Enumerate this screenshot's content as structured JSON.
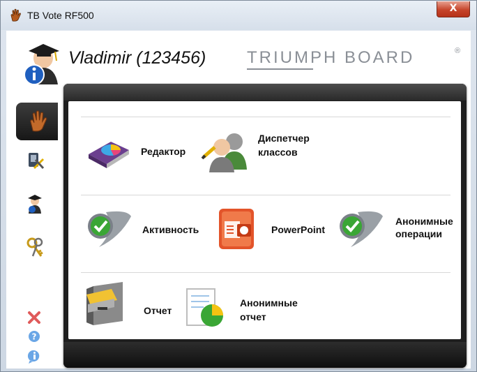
{
  "window": {
    "title": "TB Vote RF500",
    "close_glyph": "X"
  },
  "header": {
    "user": "Vladimir (123456)",
    "brand": "TRIUMPH BOARD",
    "brand_mark": "®"
  },
  "sidebar": {
    "items": [
      {
        "name": "hand-icon",
        "active": true
      },
      {
        "name": "tools-icon"
      },
      {
        "name": "student-icon"
      },
      {
        "name": "keys-icon"
      }
    ],
    "bottom": [
      {
        "name": "exit-icon"
      },
      {
        "name": "help-icon"
      },
      {
        "name": "info-icon"
      }
    ]
  },
  "menu": {
    "row1": {
      "editor": "Редактор",
      "class_manager_1": "Диспетчер",
      "class_manager_2": "классов"
    },
    "row2": {
      "activity": "Активность",
      "powerpoint": "PowerPoint",
      "anon_ops_1": "Анонимные",
      "anon_ops_2": "операции"
    },
    "row3": {
      "report": "Отчет",
      "anon_report_1": "Анонимные",
      "anon_report_2": "отчет"
    }
  },
  "colors": {
    "accent_green": "#3aa635",
    "close_red": "#c6452b",
    "panel_dark": "#1e1e1e"
  }
}
